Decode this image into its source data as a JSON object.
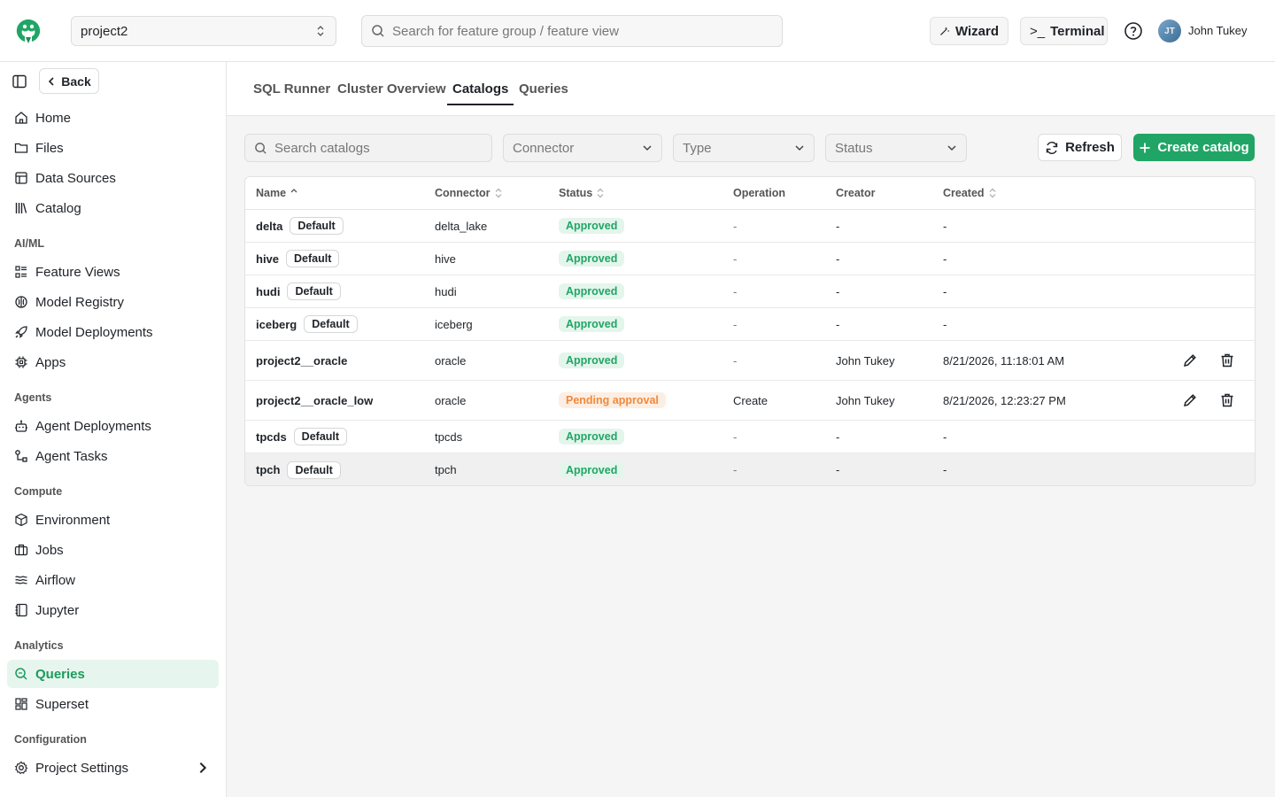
{
  "header": {
    "project": "project2",
    "search_placeholder": "Search for feature group / feature view",
    "wizard_label": "Wizard",
    "terminal_label": "Terminal",
    "terminal_prefix": ">_",
    "user_name": "John Tukey",
    "avatar_initials": "JT"
  },
  "sidebar": {
    "back_label": "Back",
    "items_top": [
      "Home",
      "Files",
      "Data Sources",
      "Catalog"
    ],
    "sections": {
      "aiml": "AI/ML",
      "agents": "Agents",
      "compute": "Compute",
      "analytics": "Analytics",
      "configuration": "Configuration"
    },
    "aiml_items": [
      "Feature Views",
      "Model Registry",
      "Model Deployments",
      "Apps"
    ],
    "agents_items": [
      "Agent Deployments",
      "Agent Tasks"
    ],
    "compute_items": [
      "Environment",
      "Jobs",
      "Airflow",
      "Jupyter"
    ],
    "analytics_items": [
      "Queries",
      "Superset"
    ],
    "config_items": [
      "Project Settings"
    ],
    "active": "Queries"
  },
  "tabs": [
    "SQL Runner",
    "Cluster Overview",
    "Catalogs",
    "Queries"
  ],
  "active_tab": "Catalogs",
  "toolbar": {
    "search_placeholder": "Search catalogs",
    "connector_placeholder": "Connector",
    "type_placeholder": "Type",
    "status_placeholder": "Status",
    "refresh_label": "Refresh",
    "create_label": "Create catalog"
  },
  "table": {
    "columns": [
      "Name",
      "Connector",
      "Status",
      "Operation",
      "Creator",
      "Created"
    ],
    "default_badge": "Default",
    "rows": [
      {
        "name": "delta",
        "default": true,
        "connector": "delta_lake",
        "status": "Approved",
        "operation": "-",
        "creator": "-",
        "created": "-",
        "editable": false
      },
      {
        "name": "hive",
        "default": true,
        "connector": "hive",
        "status": "Approved",
        "operation": "-",
        "creator": "-",
        "created": "-",
        "editable": false
      },
      {
        "name": "hudi",
        "default": true,
        "connector": "hudi",
        "status": "Approved",
        "operation": "-",
        "creator": "-",
        "created": "-",
        "editable": false
      },
      {
        "name": "iceberg",
        "default": true,
        "connector": "iceberg",
        "status": "Approved",
        "operation": "-",
        "creator": "-",
        "created": "-",
        "editable": false
      },
      {
        "name": "project2__oracle",
        "default": false,
        "connector": "oracle",
        "status": "Approved",
        "operation": "-",
        "creator": "John Tukey",
        "created": "8/21/2026, 11:18:01 AM",
        "editable": true
      },
      {
        "name": "project2__oracle_low",
        "default": false,
        "connector": "oracle",
        "status": "Pending approval",
        "operation": "Create",
        "creator": "John Tukey",
        "created": "8/21/2026, 12:23:27 PM",
        "editable": true
      },
      {
        "name": "tpcds",
        "default": true,
        "connector": "tpcds",
        "status": "Approved",
        "operation": "-",
        "creator": "-",
        "created": "-",
        "editable": false
      },
      {
        "name": "tpch",
        "default": true,
        "connector": "tpch",
        "status": "Approved",
        "operation": "-",
        "creator": "-",
        "created": "-",
        "editable": false
      }
    ]
  },
  "colors": {
    "accent": "#21a566",
    "approved_bg": "#e4f5ec",
    "pending_bg": "#fdeee3",
    "pending_text": "#f0893c"
  }
}
